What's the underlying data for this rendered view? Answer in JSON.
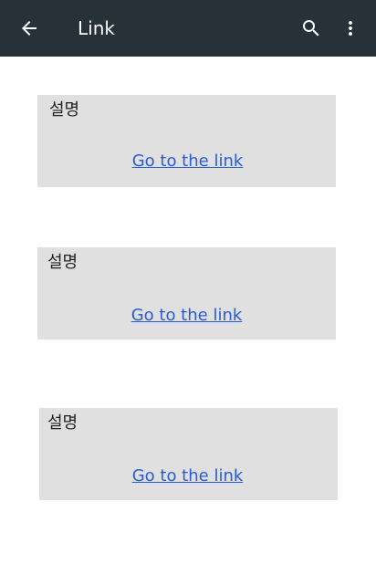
{
  "appbar": {
    "title": "Link",
    "background_color": "#263238",
    "back_icon": "arrow-left-icon",
    "search_icon": "search-icon",
    "more_icon": "more-vert-icon"
  },
  "cards": [
    {
      "description": "설명",
      "link_text": "Go to the link"
    },
    {
      "description": "설명",
      "link_text": "Go to the link"
    },
    {
      "description": "설명",
      "link_text": "Go to the link"
    }
  ],
  "colors": {
    "card_background": "#e0e0e0",
    "link": "#2a5bd7"
  }
}
